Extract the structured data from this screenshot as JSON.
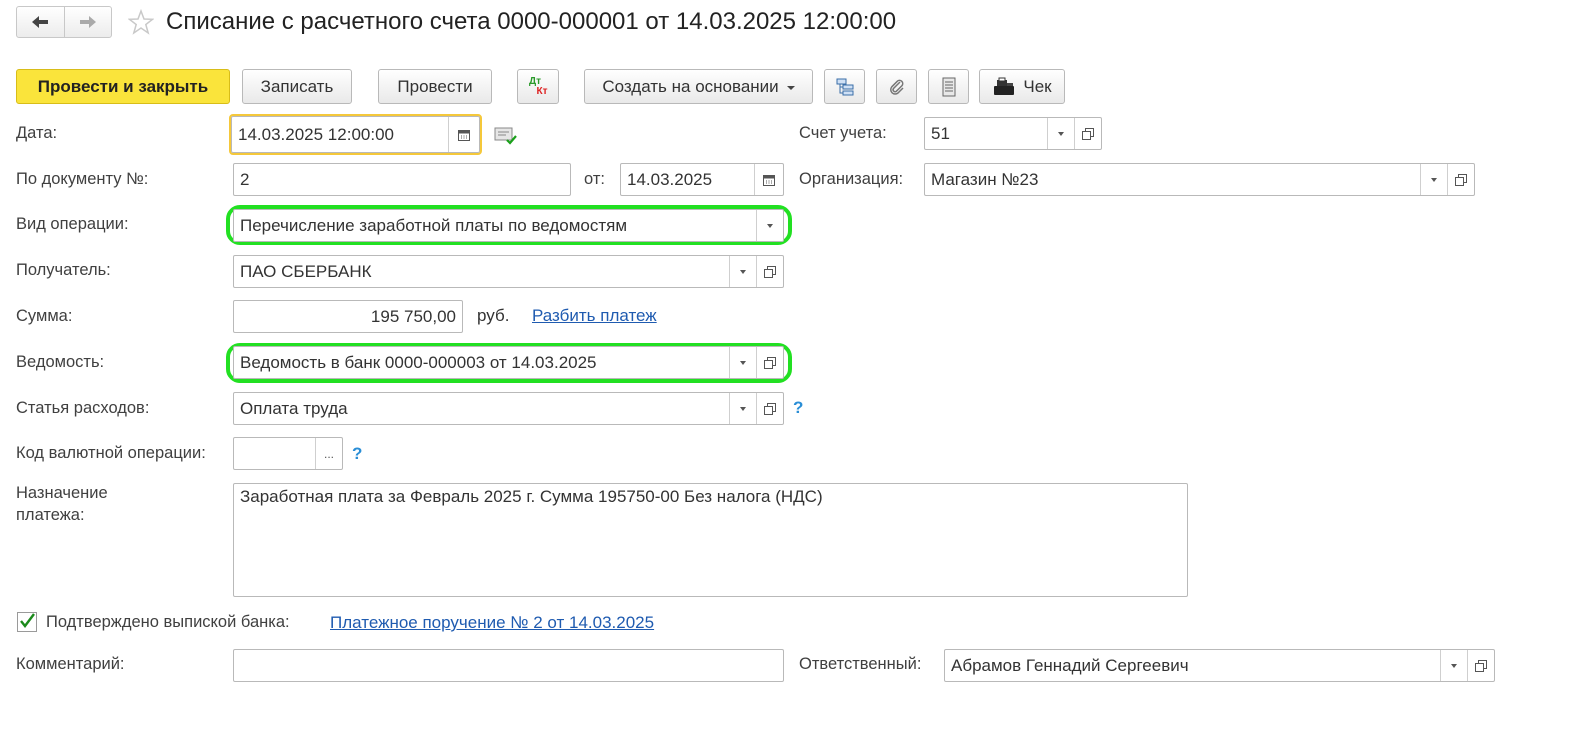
{
  "header": {
    "title": "Списание с расчетного счета 0000-000001 от 14.03.2025 12:00:00"
  },
  "toolbar": {
    "post_close": "Провести и закрыть",
    "save": "Записать",
    "post": "Провести",
    "dtkt_top": "Дт",
    "dtkt_bottom": "Кт",
    "create_based": "Создать на основании",
    "check": "Чек"
  },
  "form": {
    "date_label": "Дата:",
    "date_value": "14.03.2025 12:00:00",
    "account_label": "Счет учета:",
    "account_value": "51",
    "doc_no_label": "По документу №:",
    "doc_no_value": "2",
    "from_label": "от:",
    "from_value": "14.03.2025",
    "org_label": "Организация:",
    "org_value": "Магазин №23",
    "op_type_label": "Вид операции:",
    "op_type_value": "Перечисление заработной платы по ведомостям",
    "recipient_label": "Получатель:",
    "recipient_value": "ПАО СБЕРБАНК",
    "sum_label": "Сумма:",
    "sum_value": "195 750,00",
    "currency": "руб.",
    "split_link": "Разбить платеж",
    "statement_label": "Ведомость:",
    "statement_value": "Ведомость в банк 0000-000003 от 14.03.2025",
    "expense_label": "Статья расходов:",
    "expense_value": "Оплата труда",
    "help": "?",
    "currency_code_label": "Код валютной операции:",
    "currency_code_value": "",
    "ellipsis": "...",
    "purpose_label_1": "Назначение",
    "purpose_label_2": "платежа:",
    "purpose_value": "Заработная плата за Февраль 2025 г. Сумма 195750-00 Без налога (НДС)",
    "confirmed_label": "Подтверждено выпиской банка:",
    "confirmed_checked": true,
    "payment_order_link": "Платежное поручение № 2 от 14.03.2025",
    "comment_label": "Комментарий:",
    "comment_value": "",
    "responsible_label": "Ответственный:",
    "responsible_value": "Абрамов Геннадий Сергеевич"
  },
  "colors": {
    "primary_button": "#fae43b",
    "highlight_ring": "#22e022",
    "link": "#1f5bb0"
  }
}
